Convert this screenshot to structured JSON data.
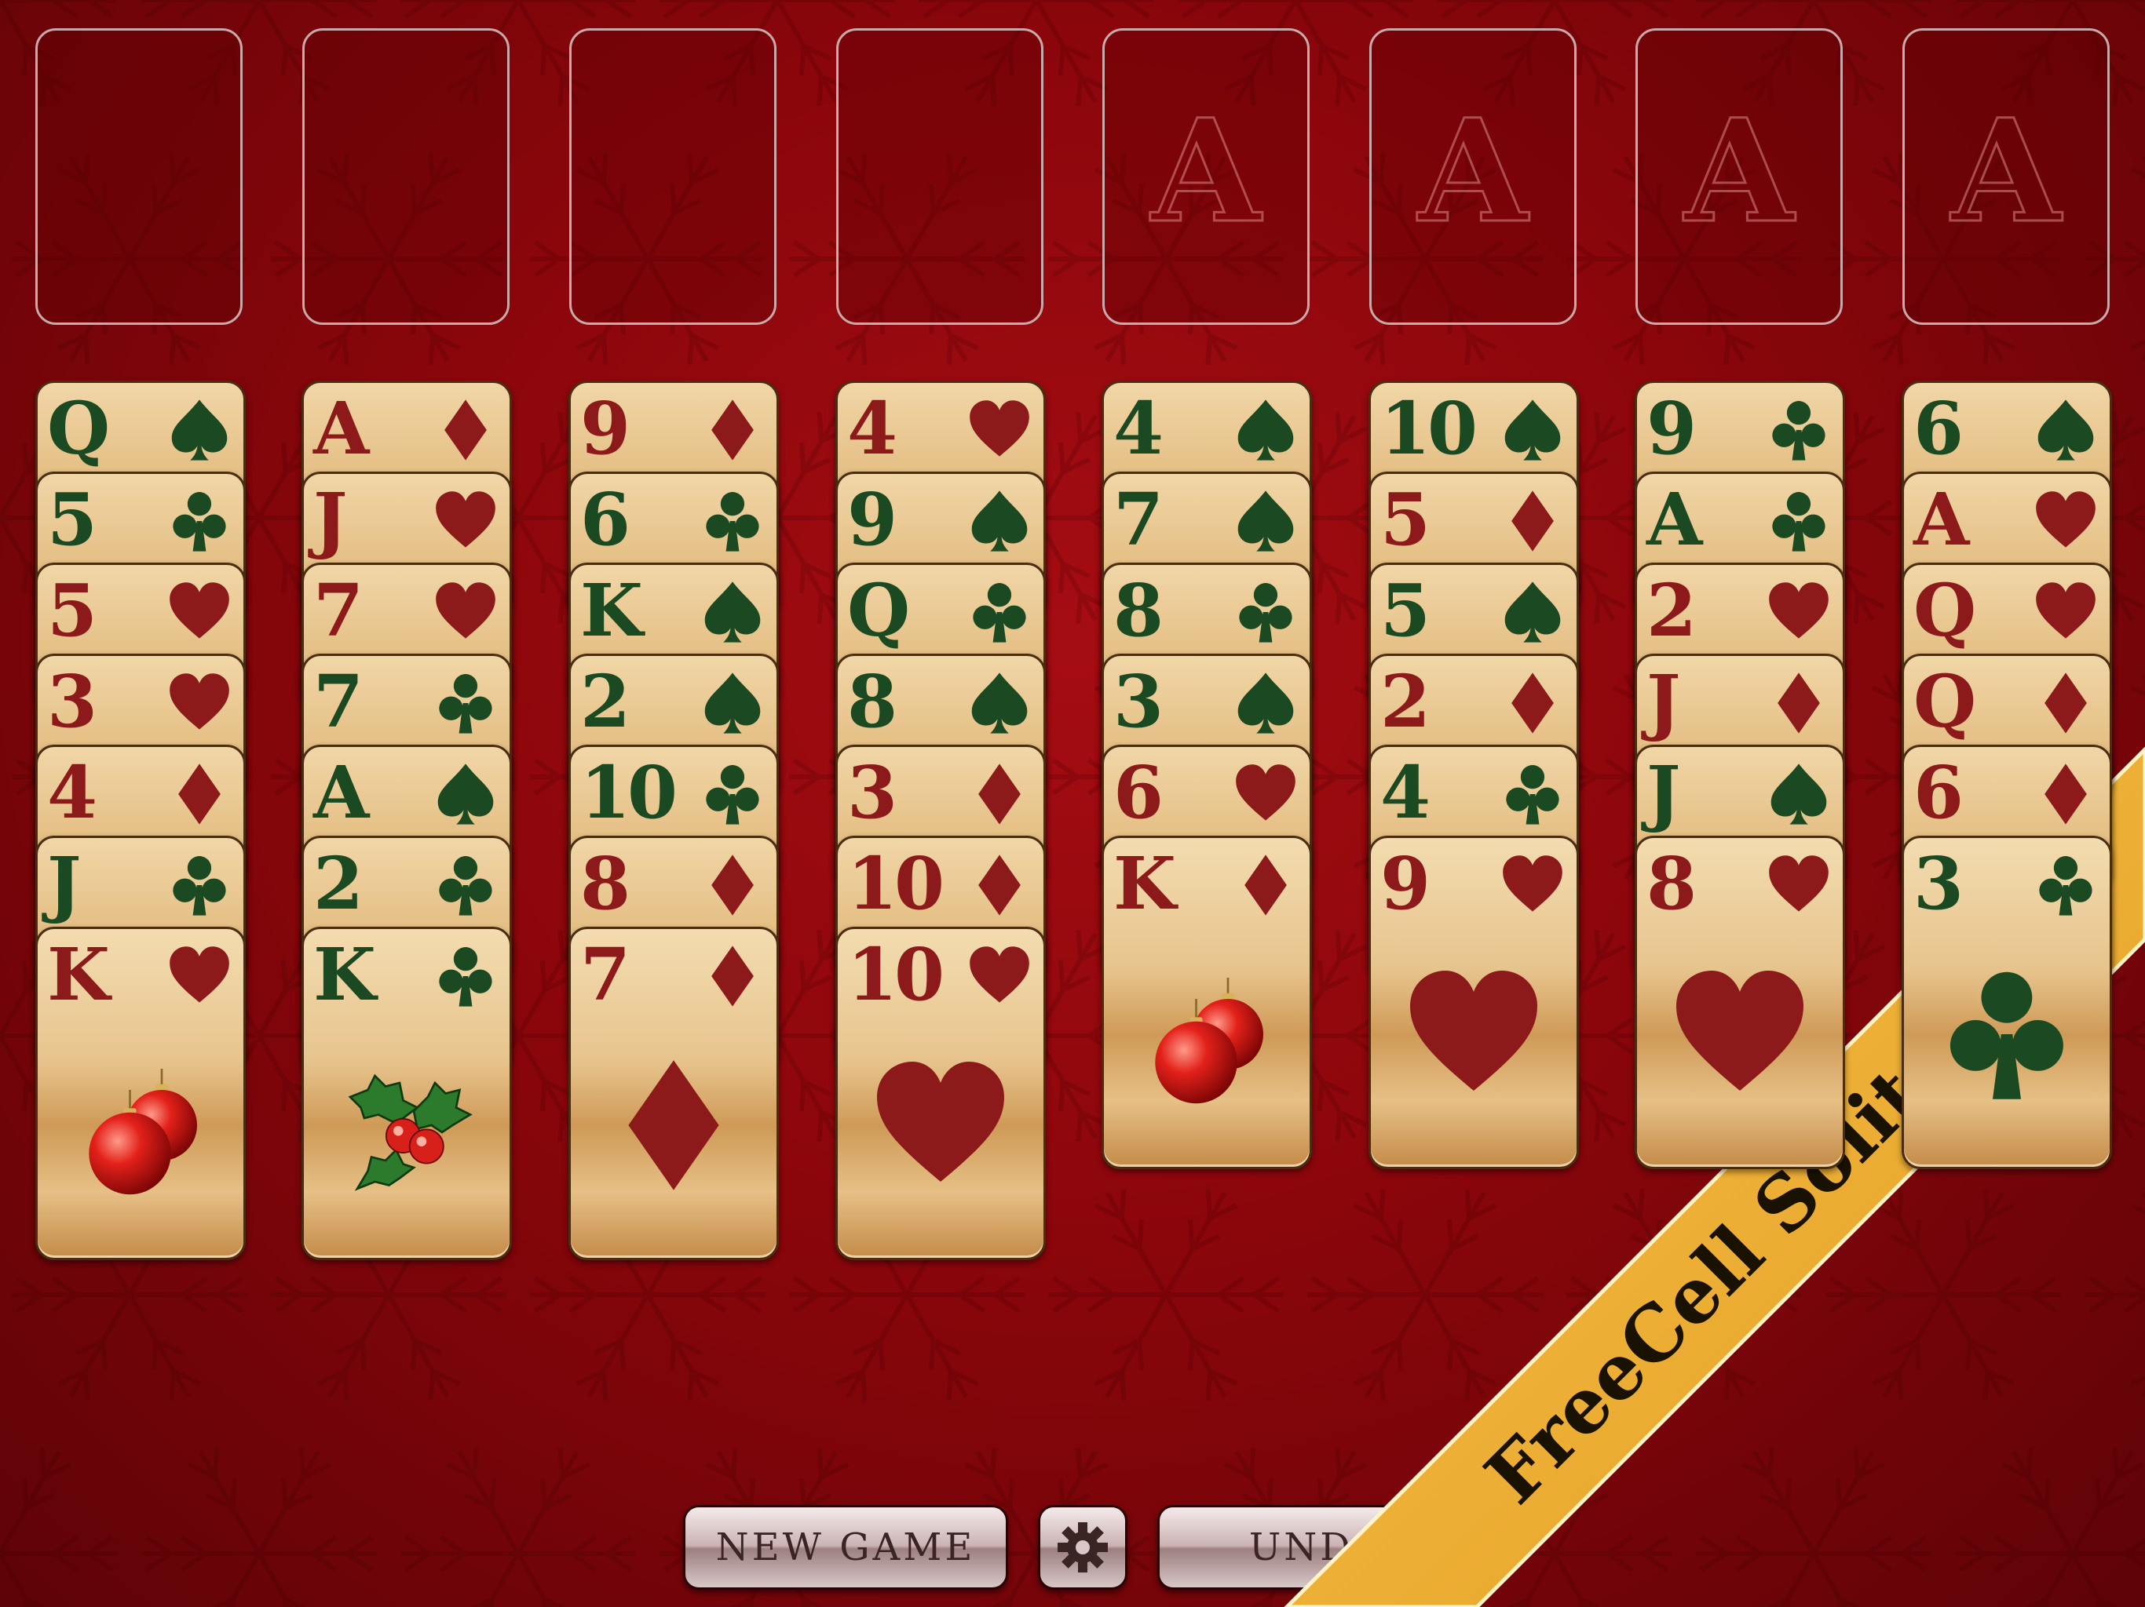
{
  "game": {
    "title": "FreeCell Solitaire"
  },
  "colors": {
    "table": "#8a060b",
    "red_suit": "#8c1a1a",
    "black_suit": "#1b4a22",
    "banner": "#f3b43a"
  },
  "top_slots": [
    {
      "type": "freecell",
      "label": ""
    },
    {
      "type": "freecell",
      "label": ""
    },
    {
      "type": "freecell",
      "label": ""
    },
    {
      "type": "freecell",
      "label": ""
    },
    {
      "type": "foundation",
      "label": "A"
    },
    {
      "type": "foundation",
      "label": "A"
    },
    {
      "type": "foundation",
      "label": "A"
    },
    {
      "type": "foundation",
      "label": "A"
    }
  ],
  "tableau": [
    [
      {
        "r": "Q",
        "s": "spade"
      },
      {
        "r": "5",
        "s": "club"
      },
      {
        "r": "5",
        "s": "heart"
      },
      {
        "r": "3",
        "s": "heart"
      },
      {
        "r": "4",
        "s": "diamond"
      },
      {
        "r": "J",
        "s": "club"
      },
      {
        "r": "K",
        "s": "heart",
        "art": "ornaments"
      }
    ],
    [
      {
        "r": "A",
        "s": "diamond"
      },
      {
        "r": "J",
        "s": "heart"
      },
      {
        "r": "7",
        "s": "heart"
      },
      {
        "r": "7",
        "s": "club"
      },
      {
        "r": "A",
        "s": "spade"
      },
      {
        "r": "2",
        "s": "club"
      },
      {
        "r": "K",
        "s": "club",
        "art": "holly"
      }
    ],
    [
      {
        "r": "9",
        "s": "diamond"
      },
      {
        "r": "6",
        "s": "club"
      },
      {
        "r": "K",
        "s": "spade"
      },
      {
        "r": "2",
        "s": "spade"
      },
      {
        "r": "10",
        "s": "club"
      },
      {
        "r": "8",
        "s": "diamond"
      },
      {
        "r": "7",
        "s": "diamond",
        "art": "pip"
      }
    ],
    [
      {
        "r": "4",
        "s": "heart"
      },
      {
        "r": "9",
        "s": "spade"
      },
      {
        "r": "Q",
        "s": "club"
      },
      {
        "r": "8",
        "s": "spade"
      },
      {
        "r": "3",
        "s": "diamond"
      },
      {
        "r": "10",
        "s": "diamond"
      },
      {
        "r": "10",
        "s": "heart",
        "art": "pip"
      }
    ],
    [
      {
        "r": "4",
        "s": "spade"
      },
      {
        "r": "7",
        "s": "spade"
      },
      {
        "r": "8",
        "s": "club"
      },
      {
        "r": "3",
        "s": "spade"
      },
      {
        "r": "6",
        "s": "heart"
      },
      {
        "r": "K",
        "s": "diamond",
        "art": "ornaments"
      }
    ],
    [
      {
        "r": "10",
        "s": "spade"
      },
      {
        "r": "5",
        "s": "diamond"
      },
      {
        "r": "5",
        "s": "spade"
      },
      {
        "r": "2",
        "s": "diamond"
      },
      {
        "r": "4",
        "s": "club"
      },
      {
        "r": "9",
        "s": "heart",
        "art": "pip"
      }
    ],
    [
      {
        "r": "9",
        "s": "club"
      },
      {
        "r": "A",
        "s": "club"
      },
      {
        "r": "2",
        "s": "heart"
      },
      {
        "r": "J",
        "s": "diamond"
      },
      {
        "r": "J",
        "s": "spade"
      },
      {
        "r": "8",
        "s": "heart",
        "art": "pip"
      }
    ],
    [
      {
        "r": "6",
        "s": "spade"
      },
      {
        "r": "A",
        "s": "heart"
      },
      {
        "r": "Q",
        "s": "heart"
      },
      {
        "r": "Q",
        "s": "diamond"
      },
      {
        "r": "6",
        "s": "diamond"
      },
      {
        "r": "3",
        "s": "club",
        "art": "pip"
      }
    ]
  ],
  "toolbar": {
    "new_game_label": "NEW GAME",
    "settings_icon": "gear-icon",
    "undo_label": "UNDO"
  }
}
